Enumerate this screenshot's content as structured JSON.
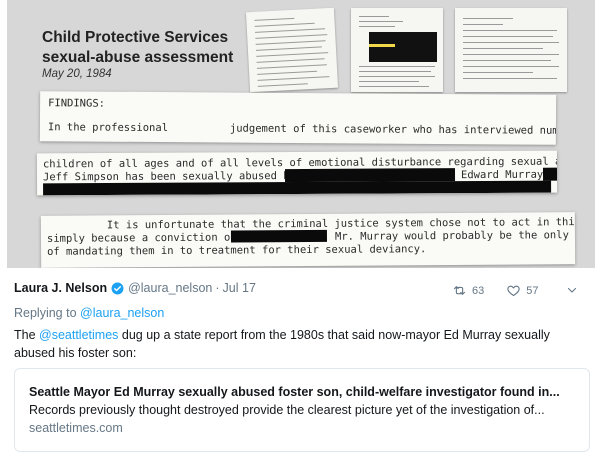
{
  "media": {
    "doc_title_line1": "Child Protective Services",
    "doc_title_line2": "sexual-abuse assessment",
    "doc_date": "May 20, 1984",
    "strip1_line1": "FINDINGS:",
    "strip1_line2a": "In the professional",
    "strip1_line2b": "judgement of this caseworker who has interviewed numerous",
    "strip2_line1": "children of all ages and of all levels of emotional disturbance regarding sexual abuse,",
    "strip2_line2a": "Jeff Simpson has been sexually abused by",
    "strip2_line2b": "Edward Murray.",
    "strip3_line1": "It is unfortunate that the criminal justice system chose not to act in this case",
    "strip3_line2a": "simply because a conviction of",
    "strip3_line2b": "Mr. Murray would probably be the only way",
    "strip3_line3": "of mandating them in to treatment for their sexual deviancy."
  },
  "tweet": {
    "author_name": "Laura J. Nelson",
    "author_handle": "@laura_nelson",
    "separator": "·",
    "date": "Jul 17",
    "retweet_count": "63",
    "like_count": "57",
    "reply_prefix": "Replying to",
    "reply_mention": "@laura_nelson",
    "text_mention": "@seattletimes",
    "text_rest": " dug up a state report from the 1980s that said now-mayor Ed Murray sexually abused his foster son:",
    "text_prefix": "The "
  },
  "card": {
    "title": "Seattle Mayor Ed Murray sexually abused foster son, child-welfare investigator found in...",
    "description": "Records previously thought destroyed provide the clearest picture yet of the investigation of...",
    "domain": "seattletimes.com"
  },
  "colors": {
    "link": "#1da1f2",
    "muted": "#657786",
    "text": "#14171a",
    "verified": "#1da1f2"
  },
  "icons": [
    "verified-badge-icon",
    "retweet-icon",
    "like-icon",
    "caret-down-icon"
  ]
}
